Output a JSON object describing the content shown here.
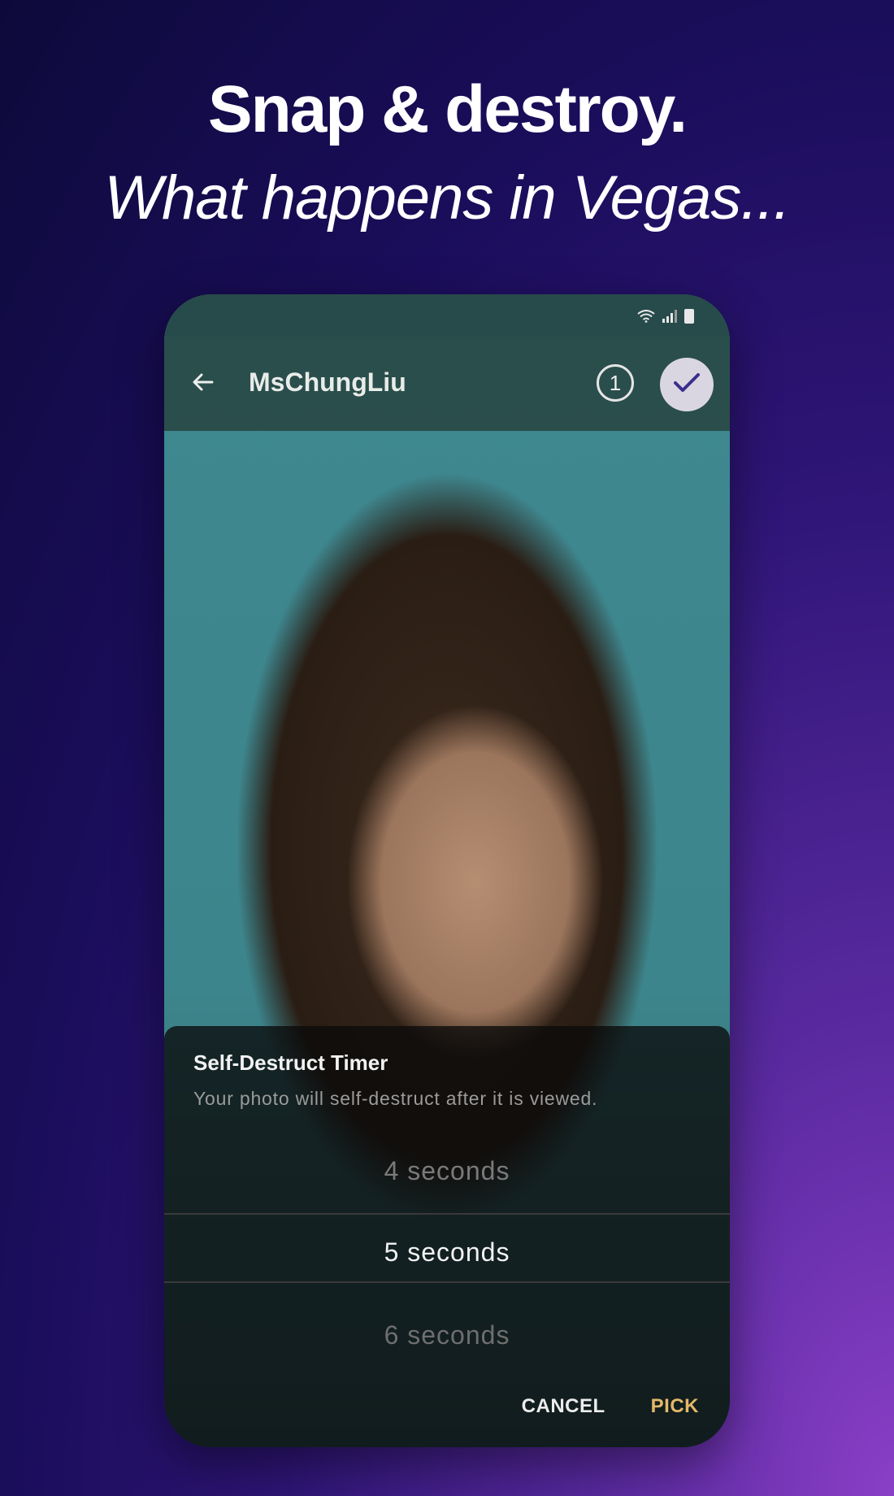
{
  "hero": {
    "title": "Snap & destroy.",
    "subtitle": "What happens in Vegas..."
  },
  "status_bar": {
    "icons": [
      "wifi-icon",
      "signal-icon",
      "battery-icon"
    ]
  },
  "app_bar": {
    "back_icon": "arrow-left-icon",
    "contact_name": "MsChungLiu",
    "count": "1",
    "send_icon": "check-icon"
  },
  "timer_sheet": {
    "title": "Self-Destruct Timer",
    "description": "Your photo will self-destruct after it is viewed.",
    "options": [
      "4  seconds",
      "5  seconds",
      "6  seconds"
    ],
    "selected_index": 1,
    "cancel_label": "CANCEL",
    "pick_label": "PICK"
  },
  "colors": {
    "accent_check": "#3a2f8c",
    "pick_color": "#e3b86a",
    "background_top": "#0d0a3a",
    "background_bottom": "#8a3fc7"
  }
}
